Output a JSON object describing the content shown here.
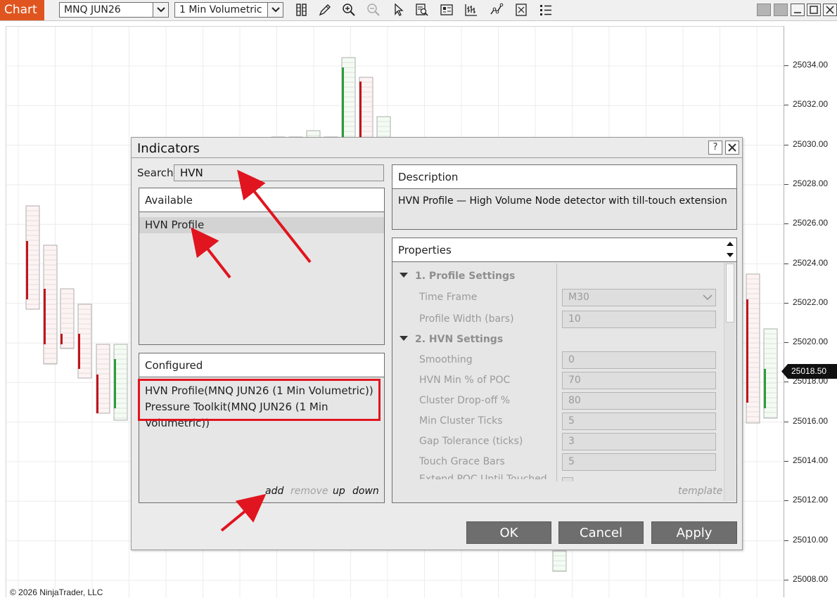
{
  "toolbar": {
    "tab_label": "Chart",
    "instrument": "MNQ JUN26",
    "timeframe": "1 Min Volumetric",
    "tool_icons": [
      "data-box-icon",
      "pencil-icon",
      "zoom-in-icon",
      "zoom-out-icon",
      "pointer-icon",
      "find-icon",
      "chart-properties-icon",
      "bar-type-icon",
      "indicators-icon",
      "strategies-icon",
      "object-list-icon"
    ]
  },
  "chart": {
    "price_labels": [
      "25034.00",
      "25032.00",
      "25030.00",
      "25028.00",
      "25026.00",
      "25024.00",
      "25022.00",
      "25020.00",
      "25018.00",
      "25016.00",
      "25014.00",
      "25012.00",
      "25010.00",
      "25008.00"
    ],
    "current_price": "25018.50",
    "copyright": "© 2026 NinjaTrader, LLC",
    "colors": {
      "up": "#2a9d3a",
      "down": "#c0141b",
      "badge": "#111111"
    }
  },
  "dialog": {
    "title": "Indicators",
    "help_label": "?",
    "search_label": "Search",
    "search_value": "HVN",
    "available": {
      "header": "Available",
      "items": [
        "HVN Profile"
      ]
    },
    "configured": {
      "header": "Configured",
      "items": [
        "HVN Profile(MNQ JUN26 (1 Min Volumetric))",
        "Pressure Toolkit(MNQ JUN26 (1 Min Volumetric))"
      ],
      "actions": {
        "add": "add",
        "remove": "remove",
        "up": "up",
        "down": "down"
      }
    },
    "description": {
      "header": "Description",
      "text": "HVN Profile — High Volume Node detector with till-touch extension"
    },
    "properties": {
      "header": "Properties",
      "sections": [
        {
          "title": "1. Profile Settings",
          "rows": [
            {
              "label": "Time Frame",
              "value": "M30",
              "kind": "select"
            },
            {
              "label": "Profile Width (bars)",
              "value": "10",
              "kind": "text"
            }
          ]
        },
        {
          "title": "2. HVN Settings",
          "rows": [
            {
              "label": "Smoothing",
              "value": "0",
              "kind": "text"
            },
            {
              "label": "HVN Min % of POC",
              "value": "70",
              "kind": "text"
            },
            {
              "label": "Cluster Drop-off %",
              "value": "80",
              "kind": "text"
            },
            {
              "label": "Min Cluster Ticks",
              "value": "5",
              "kind": "text"
            },
            {
              "label": "Gap Tolerance (ticks)",
              "value": "3",
              "kind": "text"
            },
            {
              "label": "Touch Grace Bars",
              "value": "5",
              "kind": "text"
            }
          ]
        }
      ],
      "partial_row_label": "Extend POC Until Touched",
      "template_link": "template"
    },
    "buttons": {
      "ok": "OK",
      "cancel": "Cancel",
      "apply": "Apply"
    },
    "annotation_color": "#e0151f"
  }
}
